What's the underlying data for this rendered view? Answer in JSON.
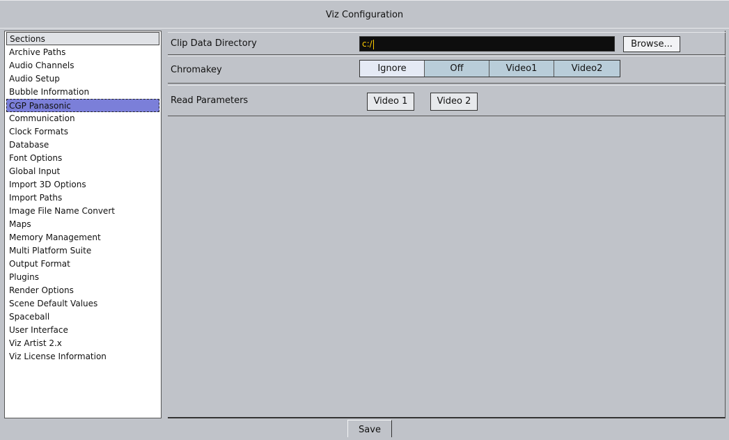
{
  "window": {
    "title": "Viz Configuration"
  },
  "sidebar": {
    "header": "Sections",
    "items": [
      "Archive Paths",
      "Audio Channels",
      "Audio Setup",
      "Bubble Information",
      "CGP Panasonic",
      "Communication",
      "Clock Formats",
      "Database",
      "Font Options",
      "Global Input",
      "Import 3D Options",
      "Import Paths",
      "Image File Name Convert",
      "Maps",
      "Memory Management",
      "Multi Platform Suite",
      "Output Format",
      "Plugins",
      "Render Options",
      "Scene Default Values",
      "Spaceball",
      "User Interface",
      "Viz Artist 2.x",
      "Viz License Information"
    ],
    "selected": "CGP Panasonic"
  },
  "main": {
    "clip_dir": {
      "label": "Clip Data Directory",
      "value": "c:/",
      "browse_label": "Browse..."
    },
    "chromakey": {
      "label": "Chromakey",
      "options": [
        "Ignore",
        "Off",
        "Video1",
        "Video2"
      ],
      "selected": "Ignore"
    },
    "read_params": {
      "label": "Read Parameters",
      "buttons": [
        "Video 1",
        "Video 2"
      ]
    }
  },
  "footer": {
    "save_label": "Save"
  },
  "colors": {
    "background": "#c0c3c9",
    "selected_item": "#7b7fd9",
    "input_bg": "#0e0e0e",
    "input_text": "#ffcc00",
    "segment_bg": "#b9cdd9",
    "segment_active": "#e5eaf5"
  }
}
